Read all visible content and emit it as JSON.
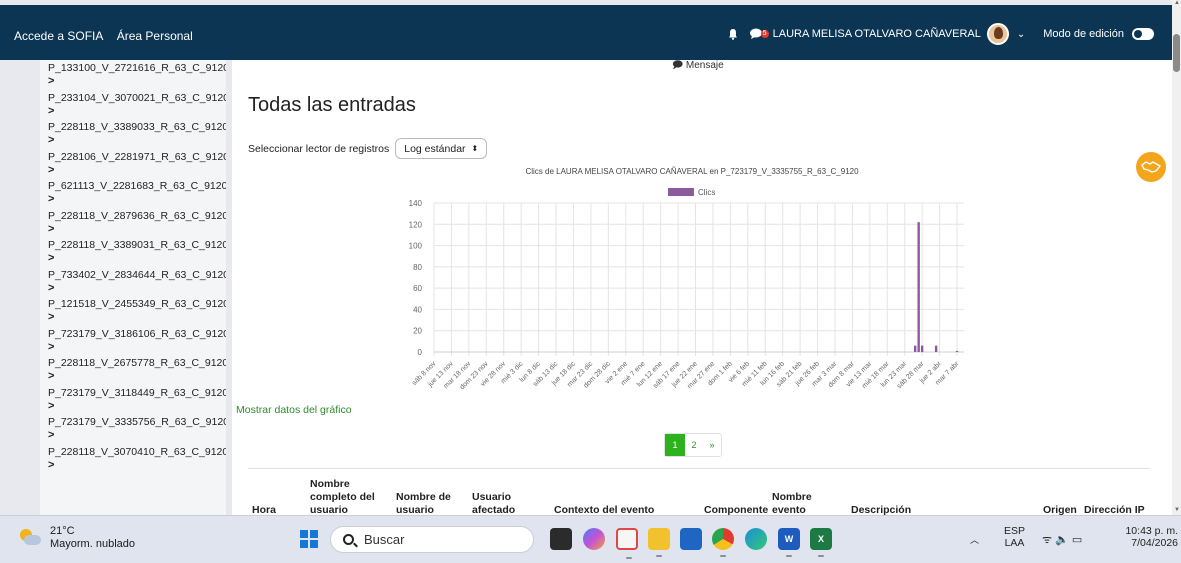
{
  "navbar": {
    "links": [
      "Accede a SOFIA",
      "Área Personal"
    ],
    "notifications_badge": "5",
    "user_name": "LAURA MELISA OTALVARO CAÑAVERAL",
    "edit_mode_label": "Modo de edición"
  },
  "sidebar": {
    "items": [
      {
        "label": "P_133100_V_2721616_R_63_C_9120"
      },
      {
        "label": "P_233104_V_3070021_R_63_C_9120"
      },
      {
        "label": "P_228118_V_3389033_R_63_C_9120"
      },
      {
        "label": "P_228106_V_2281971_R_63_C_9120"
      },
      {
        "label": "P_621113_V_2281683_R_63_C_9120"
      },
      {
        "label": "P_228118_V_2879636_R_63_C_9120"
      },
      {
        "label": "P_228118_V_3389031_R_63_C_9120"
      },
      {
        "label": "P_733402_V_2834644_R_63_C_9120"
      },
      {
        "label": "P_121518_V_2455349_R_63_C_9120"
      },
      {
        "label": "P_723179_V_3186106_R_63_C_9120"
      },
      {
        "label": "P_228118_V_2675778_R_63_C_9120"
      },
      {
        "label": "P_723179_V_3118449_R_63_C_9120"
      },
      {
        "label": "P_723179_V_3335756_R_63_C_9120"
      },
      {
        "label": "P_228118_V_3070410_R_63_C_9120"
      }
    ],
    "chevron": ">"
  },
  "main": {
    "mensaje_label": "Mensaje",
    "title": "Todas las entradas",
    "reader_label": "Seleccionar lector de registros",
    "reader_value": "Log estándar",
    "show_chart_data": "Mostrar datos del gráfico",
    "pagination": [
      "1",
      "2",
      "»"
    ],
    "table_headers": [
      "Hora",
      "Nombre completo del usuario",
      "Nombre de usuario",
      "Usuario afectado",
      "Contexto del evento",
      "Componente",
      "Nombre evento",
      "Descripción",
      "Origen",
      "Dirección IP"
    ]
  },
  "chart_data": {
    "type": "bar",
    "title": "Clics de LAURA MELISA OTALVARO CAÑAVERAL en P_723179_V_3335755_R_63_C_9120",
    "legend": [
      "Clics"
    ],
    "legend_position": "top",
    "series_color": "#8c5a9e",
    "ylim": [
      0,
      140
    ],
    "yticks": [
      0,
      20,
      40,
      60,
      80,
      100,
      120,
      140
    ],
    "grid": true,
    "xtick_labels": [
      "sáb 8 nov",
      "jue 13 nov",
      "mar 18 nov",
      "dom 23 nov",
      "vie 28 nov",
      "mié 3 dic",
      "lun 8 dic",
      "sáb 13 dic",
      "jue 18 dic",
      "mar 23 dic",
      "dom 28 dic",
      "vie 2 ene",
      "mié 7 ene",
      "lun 12 ene",
      "sáb 17 ene",
      "jue 22 ene",
      "mar 27 ene",
      "dom 1 feb",
      "vie 6 feb",
      "mié 11 feb",
      "lun 16 feb",
      "sáb 21 feb",
      "jue 26 feb",
      "mar 3 mar",
      "dom 8 mar",
      "vie 13 mar",
      "mié 18 mar",
      "lun 23 mar",
      "sáb 28 mar",
      "jue 2 abr",
      "mar 7 abr"
    ],
    "series": [
      {
        "name": "Clics",
        "x": [
          "2026-03-26",
          "2026-03-27",
          "2026-03-28",
          "2026-03-29",
          "2026-04-01",
          "2026-04-07"
        ],
        "values": [
          6,
          122,
          6,
          0,
          6,
          1
        ]
      }
    ]
  },
  "taskbar": {
    "temperature": "21°C",
    "weather_text": "Mayorm. nublado",
    "search_placeholder": "Buscar",
    "lang_top": "ESP",
    "lang_bottom": "LAA",
    "time": "10:43 p. m.",
    "date": "7/04/2026"
  }
}
